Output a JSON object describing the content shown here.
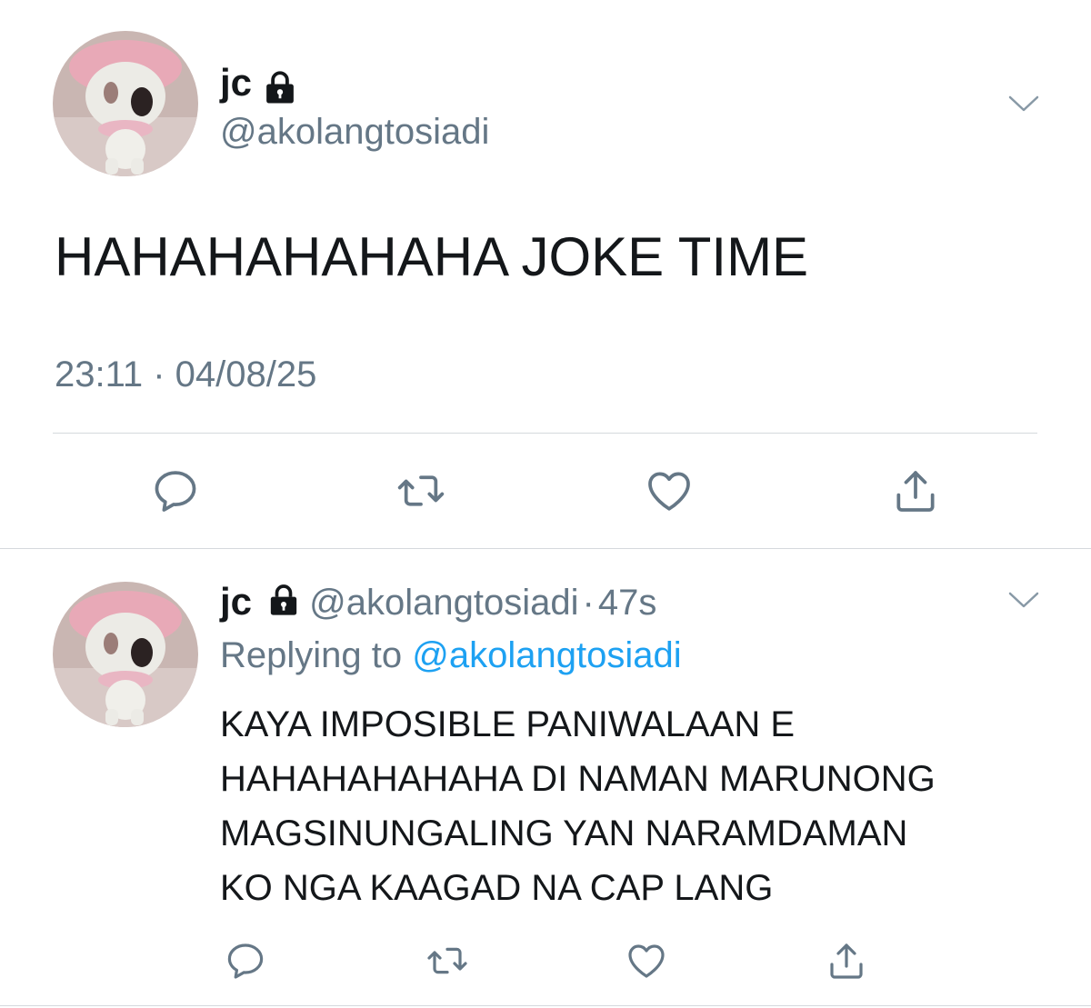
{
  "main_tweet": {
    "display_name": "jc",
    "handle": "@akolangtosiadi",
    "text": "HAHAHAHAHAHA JOKE TIME",
    "timestamp": "23:11 · 04/08/25",
    "icons": [
      "lock-icon",
      "chevron-down-icon",
      "reply-icon",
      "retweet-icon",
      "like-icon",
      "share-icon"
    ]
  },
  "reply_tweet": {
    "display_name": "jc",
    "handle": "@akolangtosiadi",
    "separator": "·",
    "age": "47s",
    "replying_prefix": "Replying to",
    "replying_handle": "@akolangtosiadi",
    "text_lines": [
      "KAYA IMPOSIBLE PANIWALAAN E",
      "HAHAHAHAHAHA DI NAMAN MARUNONG",
      "MAGSINUNGALING YAN NARAMDAMAN",
      "KO NGA KAAGAD NA CAP LANG"
    ]
  },
  "colors": {
    "text_primary": "#14171a",
    "text_secondary": "#657786",
    "link": "#1da1f2",
    "divider": "#e1e8ed",
    "icon": "#657786"
  }
}
